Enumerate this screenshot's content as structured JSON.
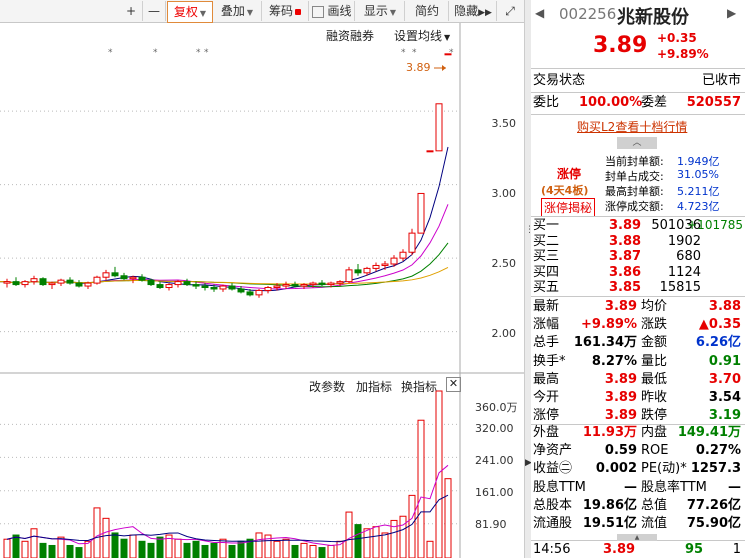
{
  "toolbar": {
    "buttons": [
      {
        "label": "+"
      },
      {
        "label": "—"
      },
      {
        "label": "复权"
      },
      {
        "label": "叠加"
      },
      {
        "label": "筹码"
      },
      {
        "label": "画线"
      },
      {
        "label": "显示"
      },
      {
        "label": "简约"
      },
      {
        "label": "隐藏"
      }
    ]
  },
  "chart": {
    "rzrq_label": "融资融券",
    "ma_setting_label": "设置均线",
    "price_marker": "3.89",
    "y_ticks": [
      "3.50",
      "3.00",
      "2.50",
      "2.00"
    ],
    "volume_controls": [
      "改参数",
      "加指标",
      "换指标"
    ],
    "volume_ticks": [
      "360.0万",
      "320.00",
      "241.00",
      "161.00",
      "81.90"
    ],
    "colors": {
      "up": "#e60000",
      "down": "#008000",
      "ma5": "#000080",
      "ma10": "#cc00cc",
      "ma20": "#008000",
      "ma60": "#e0a000"
    }
  },
  "chart_data": {
    "type": "candlestick",
    "price_ylim": [
      1.8,
      3.95
    ],
    "last_close": 3.89,
    "candles": [
      [
        2.33,
        2.36,
        2.3,
        2.34
      ],
      [
        2.34,
        2.37,
        2.31,
        2.32
      ],
      [
        2.32,
        2.35,
        2.3,
        2.34
      ],
      [
        2.34,
        2.38,
        2.32,
        2.36
      ],
      [
        2.36,
        2.37,
        2.31,
        2.32
      ],
      [
        2.32,
        2.34,
        2.29,
        2.33
      ],
      [
        2.33,
        2.36,
        2.31,
        2.35
      ],
      [
        2.35,
        2.37,
        2.32,
        2.33
      ],
      [
        2.33,
        2.35,
        2.3,
        2.31
      ],
      [
        2.31,
        2.34,
        2.29,
        2.33
      ],
      [
        2.33,
        2.38,
        2.32,
        2.37
      ],
      [
        2.37,
        2.42,
        2.35,
        2.4
      ],
      [
        2.4,
        2.44,
        2.37,
        2.38
      ],
      [
        2.38,
        2.4,
        2.35,
        2.36
      ],
      [
        2.36,
        2.38,
        2.33,
        2.37
      ],
      [
        2.37,
        2.39,
        2.34,
        2.35
      ],
      [
        2.35,
        2.36,
        2.31,
        2.32
      ],
      [
        2.32,
        2.34,
        2.29,
        2.3
      ],
      [
        2.3,
        2.33,
        2.28,
        2.32
      ],
      [
        2.32,
        2.35,
        2.3,
        2.34
      ],
      [
        2.34,
        2.36,
        2.31,
        2.32
      ],
      [
        2.32,
        2.34,
        2.29,
        2.31
      ],
      [
        2.31,
        2.33,
        2.28,
        2.3
      ],
      [
        2.3,
        2.32,
        2.27,
        2.29
      ],
      [
        2.29,
        2.32,
        2.27,
        2.31
      ],
      [
        2.31,
        2.33,
        2.28,
        2.29
      ],
      [
        2.29,
        2.31,
        2.26,
        2.27
      ],
      [
        2.27,
        2.29,
        2.24,
        2.25
      ],
      [
        2.25,
        2.29,
        2.23,
        2.28
      ],
      [
        2.28,
        2.31,
        2.26,
        2.3
      ],
      [
        2.3,
        2.33,
        2.28,
        2.31
      ],
      [
        2.31,
        2.34,
        2.29,
        2.32
      ],
      [
        2.32,
        2.34,
        2.3,
        2.31
      ],
      [
        2.31,
        2.33,
        2.29,
        2.32
      ],
      [
        2.32,
        2.34,
        2.3,
        2.33
      ],
      [
        2.33,
        2.35,
        2.31,
        2.32
      ],
      [
        2.32,
        2.34,
        2.3,
        2.33
      ],
      [
        2.33,
        2.35,
        2.31,
        2.34
      ],
      [
        2.34,
        2.44,
        2.33,
        2.42
      ],
      [
        2.42,
        2.46,
        2.38,
        2.4
      ],
      [
        2.4,
        2.44,
        2.38,
        2.43
      ],
      [
        2.43,
        2.47,
        2.41,
        2.45
      ],
      [
        2.45,
        2.48,
        2.42,
        2.46
      ],
      [
        2.46,
        2.52,
        2.44,
        2.5
      ],
      [
        2.5,
        2.56,
        2.48,
        2.54
      ],
      [
        2.54,
        2.7,
        2.52,
        2.67
      ],
      [
        2.67,
        2.94,
        2.67,
        2.94
      ],
      [
        3.23,
        3.23,
        3.23,
        3.23
      ],
      [
        3.23,
        3.55,
        3.23,
        3.55
      ],
      [
        3.89,
        3.89,
        3.89,
        3.89
      ]
    ],
    "volume_ylim": [
      0,
      400
    ],
    "volumes": [
      [
        45,
        1
      ],
      [
        55,
        0
      ],
      [
        40,
        1
      ],
      [
        70,
        1
      ],
      [
        35,
        0
      ],
      [
        30,
        0
      ],
      [
        50,
        1
      ],
      [
        30,
        0
      ],
      [
        25,
        0
      ],
      [
        40,
        1
      ],
      [
        120,
        1
      ],
      [
        95,
        1
      ],
      [
        60,
        0
      ],
      [
        45,
        0
      ],
      [
        55,
        1
      ],
      [
        40,
        0
      ],
      [
        35,
        0
      ],
      [
        50,
        0
      ],
      [
        55,
        1
      ],
      [
        45,
        1
      ],
      [
        35,
        0
      ],
      [
        40,
        0
      ],
      [
        30,
        0
      ],
      [
        35,
        0
      ],
      [
        45,
        1
      ],
      [
        30,
        0
      ],
      [
        40,
        0
      ],
      [
        45,
        0
      ],
      [
        60,
        1
      ],
      [
        55,
        1
      ],
      [
        40,
        1
      ],
      [
        45,
        1
      ],
      [
        30,
        0
      ],
      [
        35,
        1
      ],
      [
        30,
        1
      ],
      [
        25,
        0
      ],
      [
        30,
        1
      ],
      [
        40,
        1
      ],
      [
        110,
        1
      ],
      [
        80,
        0
      ],
      [
        70,
        1
      ],
      [
        75,
        1
      ],
      [
        60,
        1
      ],
      [
        90,
        1
      ],
      [
        100,
        1
      ],
      [
        150,
        1
      ],
      [
        330,
        1
      ],
      [
        40,
        1
      ],
      [
        400,
        1
      ],
      [
        190,
        1
      ]
    ]
  },
  "panel": {
    "code": "002256",
    "name": "兆新股份",
    "price": "3.89",
    "change": "+0.35",
    "change_pct": "+9.89%",
    "status_label": "交易状态",
    "status_value": "已收市",
    "wb_label": "委比",
    "wb_value": "100.00%",
    "wc_label": "委差",
    "wc_value": "520557",
    "l2_link": "购买L2查看十档行情",
    "limit_title": "涨停",
    "limit_boards": "(4天4板)",
    "limit_button": "涨停揭秘",
    "seal_items": [
      {
        "label": "当前封单额:",
        "value": "1.949亿"
      },
      {
        "label": "封单占成交:",
        "value": "31.05%"
      },
      {
        "label": "最高封单额:",
        "value": "5.211亿"
      },
      {
        "label": "涨停成交额:",
        "value": "4.723亿"
      }
    ],
    "bids": [
      {
        "label": "买一",
        "price": "3.89",
        "vol": "501036",
        "extra": "+101785"
      },
      {
        "label": "买二",
        "price": "3.88",
        "vol": "1902",
        "extra": ""
      },
      {
        "label": "买三",
        "price": "3.87",
        "vol": "680",
        "extra": ""
      },
      {
        "label": "买四",
        "price": "3.86",
        "vol": "1124",
        "extra": ""
      },
      {
        "label": "买五",
        "price": "3.85",
        "vol": "15815",
        "extra": ""
      }
    ],
    "stats": [
      {
        "l1": "最新",
        "v1": "3.89",
        "c1": "red",
        "l2": "均价",
        "v2": "3.88",
        "c2": "red"
      },
      {
        "l1": "涨幅",
        "v1": "+9.89%",
        "c1": "red",
        "l2": "涨跌",
        "v2": "▲0.35",
        "c2": "red"
      },
      {
        "l1": "总手",
        "v1": "161.34万",
        "c1": "",
        "l2": "金额",
        "v2": "6.26亿",
        "c2": "blue"
      },
      {
        "l1": "换手*",
        "v1": "8.27%",
        "c1": "",
        "l2": "量比",
        "v2": "0.91",
        "c2": "green"
      },
      {
        "l1": "最高",
        "v1": "3.89",
        "c1": "red",
        "l2": "最低",
        "v2": "3.70",
        "c2": "red"
      },
      {
        "l1": "今开",
        "v1": "3.89",
        "c1": "red",
        "l2": "昨收",
        "v2": "3.54",
        "c2": ""
      },
      {
        "l1": "涨停",
        "v1": "3.89",
        "c1": "red",
        "l2": "跌停",
        "v2": "3.19",
        "c2": "green"
      }
    ],
    "stats2": [
      {
        "l1": "外盘",
        "v1": "11.93万",
        "c1": "red",
        "l2": "内盘",
        "v2": "149.41万",
        "c2": "green"
      },
      {
        "l1": "净资产",
        "v1": "0.59",
        "c1": "",
        "l2": "ROE",
        "v2": "0.27%",
        "c2": ""
      },
      {
        "l1": "收益㊁",
        "v1": "0.002",
        "c1": "",
        "l2": "PE(动)*",
        "v2": "1257.3",
        "c2": ""
      },
      {
        "l1": "股息TTM",
        "v1": "—",
        "c1": "",
        "l2": "股息率TTM",
        "v2": "—",
        "c2": ""
      },
      {
        "l1": "总股本",
        "v1": "19.86亿",
        "c1": "",
        "l2": "总值",
        "v2": "77.26亿",
        "c2": ""
      },
      {
        "l1": "流通股",
        "v1": "19.51亿",
        "c1": "",
        "l2": "流值",
        "v2": "75.90亿",
        "c2": ""
      }
    ],
    "tick": {
      "time": "14:56",
      "price": "3.89",
      "vol": "95",
      "num": "1"
    }
  }
}
